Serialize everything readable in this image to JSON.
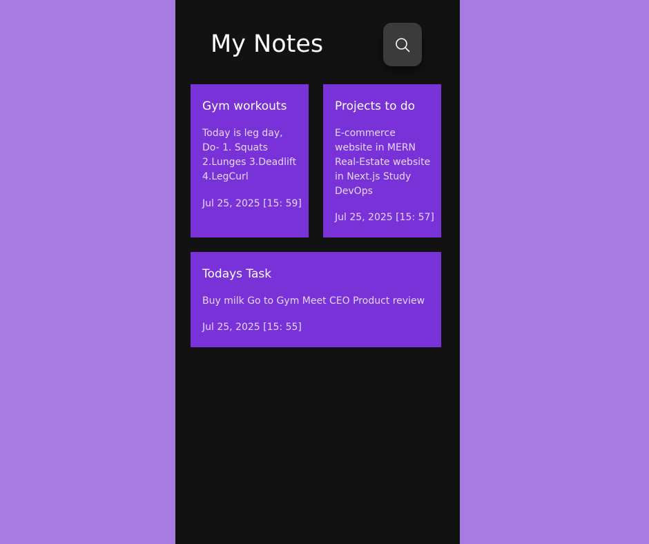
{
  "app": {
    "title": "My Notes"
  },
  "search": {
    "icon": "search-icon"
  },
  "colors": {
    "background": "#a67ce3",
    "app_background": "#121212",
    "note_card": "#7832d7",
    "search_button": "#3b3b3b"
  },
  "notes": [
    {
      "title": "Gym workouts",
      "body": "Today is leg day, Do- 1. Squats 2.Lunges 3.Deadlift 4.LegCurl",
      "date": "Jul 25, 2025 [15: 59]"
    },
    {
      "title": "Projects to do",
      "body": "E-commerce website in MERN Real-Estate website in Next.js Study DevOps",
      "date": "Jul 25, 2025 [15: 57]"
    },
    {
      "title": "Todays Task",
      "body": "Buy milk Go to Gym Meet CEO Product review",
      "date": "Jul 25, 2025 [15: 55]"
    }
  ]
}
